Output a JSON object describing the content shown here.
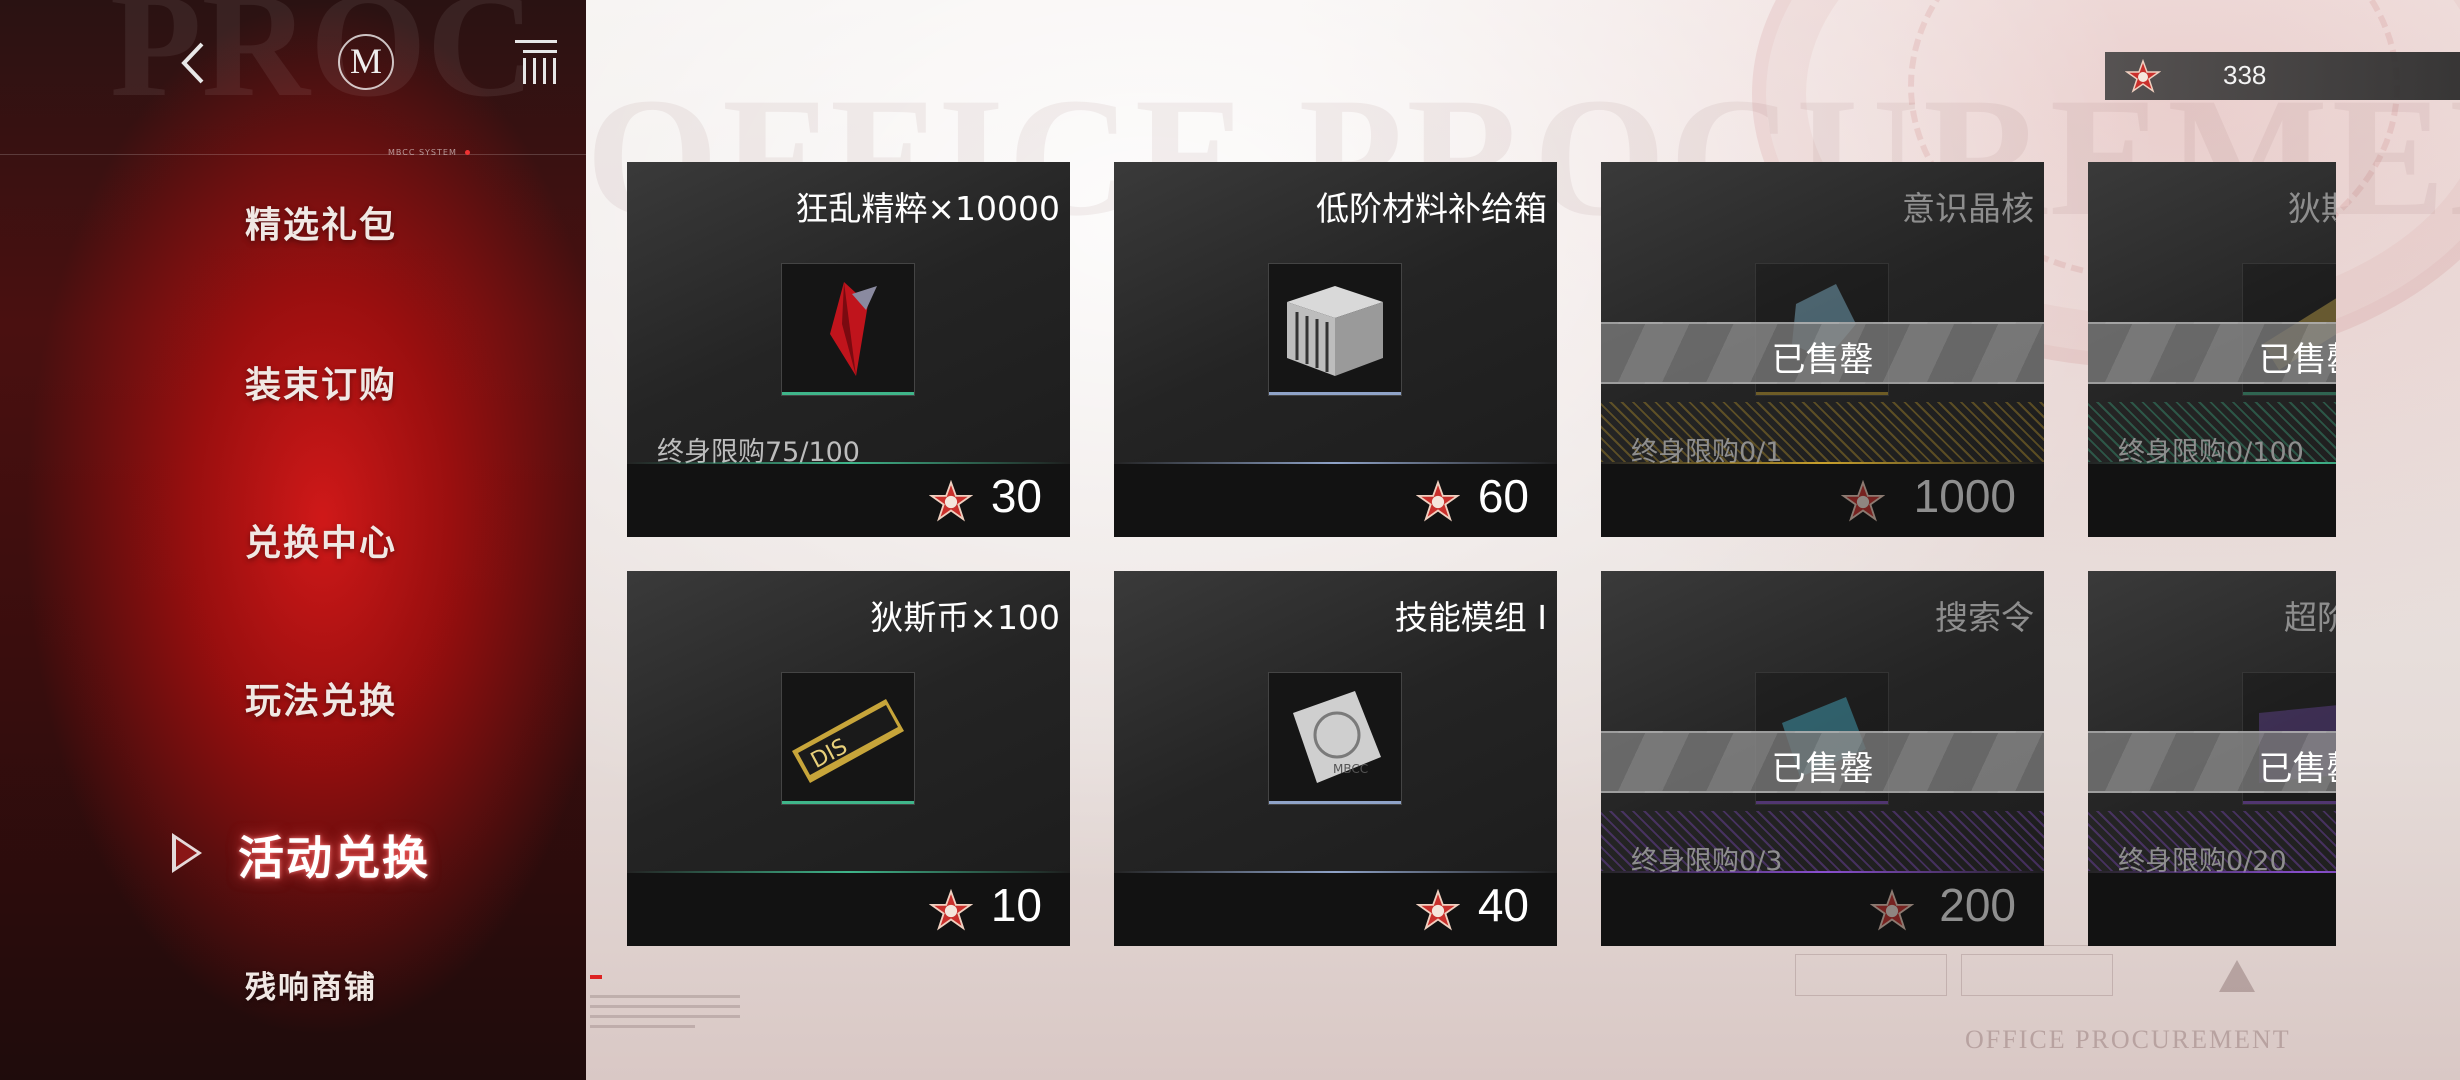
{
  "sidebar": {
    "bg_text": "PROC",
    "system_label": "MBCC SYSTEM",
    "logo_letter": "M",
    "items": [
      {
        "label": "精选礼包",
        "active": false
      },
      {
        "label": "装束订购",
        "active": false
      },
      {
        "label": "兑换中心",
        "active": false
      },
      {
        "label": "玩法兑换",
        "active": false
      },
      {
        "label": "活动兑换",
        "active": true
      },
      {
        "label": "残响商铺",
        "active": false
      }
    ]
  },
  "currency": {
    "icon": "star-token-icon",
    "amount": "338"
  },
  "background": {
    "big_text": "OFFICE PROCUREMENT",
    "footer_text": "OFFICE PROCUREMENT"
  },
  "shop": {
    "sold_out_label": "已售罄",
    "items": [
      {
        "name": "狂乱精粹×10000",
        "limit": "终身限购75/100",
        "price": "30",
        "sold_out": false,
        "accent": "#3fb58a",
        "icon": "red-crystal-icon"
      },
      {
        "name": "低阶材料补给箱",
        "limit": "",
        "price": "60",
        "sold_out": false,
        "accent": "#8fa3c8",
        "icon": "supply-crate-icon"
      },
      {
        "name": "意识晶核",
        "limit": "终身限购0/1",
        "price": "1000",
        "sold_out": true,
        "accent": "#c9a12c",
        "icon": "blue-crystal-icon"
      },
      {
        "name": "狄斯",
        "limit": "终身限购0/100",
        "price": "",
        "sold_out": true,
        "accent": "#3fb58a",
        "icon": "gold-ticket-icon"
      },
      {
        "name": "狄斯币×100",
        "limit": "",
        "price": "10",
        "sold_out": false,
        "accent": "#3fb58a",
        "icon": "dis-coin-icon"
      },
      {
        "name": "技能模组 I",
        "limit": "",
        "price": "40",
        "sold_out": false,
        "accent": "#8fa3c8",
        "icon": "skill-module-icon"
      },
      {
        "name": "搜索令",
        "limit": "终身限购0/3",
        "price": "200",
        "sold_out": true,
        "accent": "#8a4fd0",
        "icon": "search-order-icon"
      },
      {
        "name": "超阶",
        "limit": "终身限购0/20",
        "price": "",
        "sold_out": true,
        "accent": "#8a4fd0",
        "icon": "purple-crate-icon"
      }
    ]
  }
}
